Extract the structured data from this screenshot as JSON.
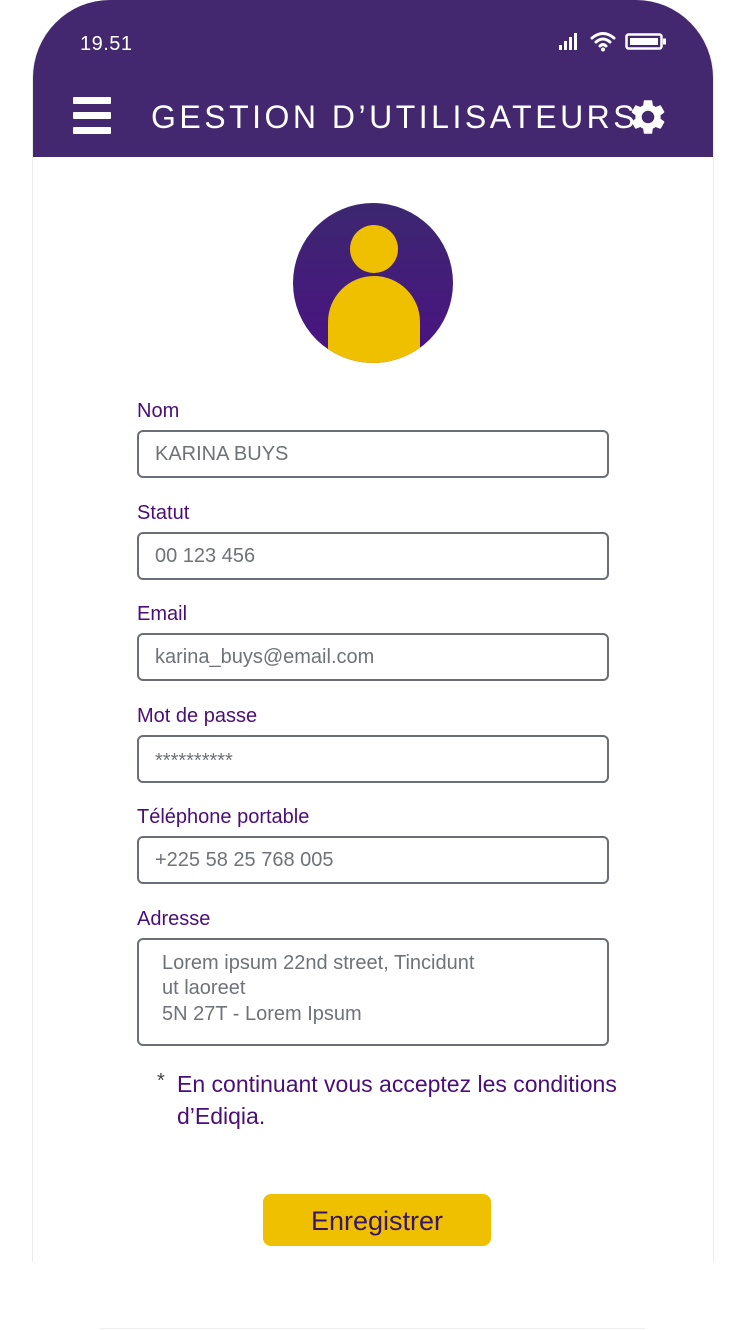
{
  "status_bar": {
    "time": "19.51",
    "icons": [
      "signal-icon",
      "wifi-icon",
      "battery-icon"
    ]
  },
  "header": {
    "title": "GESTION D’UTILISATEURS",
    "menu_icon": "hamburger-menu-icon",
    "settings_icon": "gear-icon",
    "background_color": "#44286f"
  },
  "avatar": {
    "icon": "user-avatar-icon",
    "background_color": "#4b1283",
    "figure_color": "#efc000"
  },
  "form": {
    "fields": [
      {
        "label": "Nom",
        "value": "KARINA BUYS"
      },
      {
        "label": "Statut",
        "value": "00 123 456"
      },
      {
        "label": "Email",
        "value": "karina_buys@email.com"
      },
      {
        "label": "Mot de passe",
        "value": "**********"
      },
      {
        "label": "Téléphone portable",
        "value": "+225 58 25 768 005"
      }
    ],
    "address": {
      "label": "Adresse",
      "lines": [
        "Lorem ipsum 22nd street, Tincidunt",
        "ut laoreet",
        "5N 27T - Lorem Ipsum"
      ]
    },
    "note_marker": "*",
    "note": "En continuant vous acceptez les conditions d’Ediqia.",
    "submit_label": "Enregistrer"
  },
  "colors": {
    "accent": "#efc000",
    "label_text": "#4a0e78",
    "field_border": "#6b6e74"
  }
}
